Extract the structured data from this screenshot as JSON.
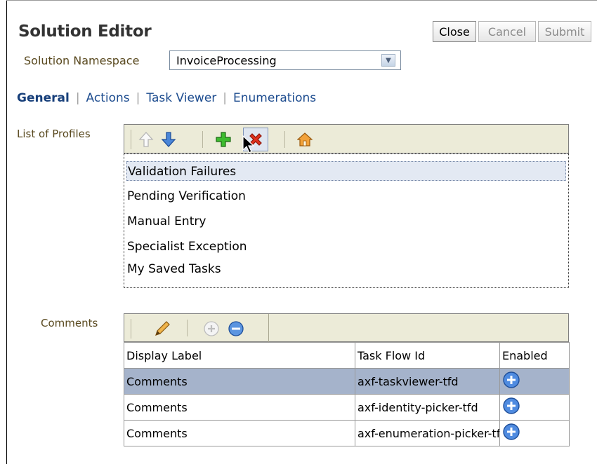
{
  "header": {
    "title": "Solution Editor",
    "buttons": {
      "close": "Close",
      "cancel": "Cancel",
      "submit": "Submit"
    }
  },
  "namespace": {
    "label": "Solution Namespace",
    "value": "InvoiceProcessing"
  },
  "tabs": [
    {
      "label": "General",
      "active": true
    },
    {
      "label": "Actions"
    },
    {
      "label": "Task Viewer"
    },
    {
      "label": "Enumerations"
    }
  ],
  "profiles": {
    "label": "List of Profiles",
    "toolbar_icons": [
      "move-up-icon",
      "move-down-icon",
      "add-icon",
      "delete-icon",
      "home-icon"
    ],
    "items": [
      "Validation Failures",
      "Pending Verification",
      "Manual Entry",
      "Specialist Exception",
      "My Saved Tasks"
    ]
  },
  "comments": {
    "label": "Comments",
    "toolbar_icons": [
      "edit-pencil-icon",
      "add-icon",
      "remove-icon"
    ],
    "columns": [
      "Display Label",
      "Task Flow Id",
      "Enabled"
    ],
    "rows": [
      {
        "label": "Comments",
        "task_flow_id": "axf-taskviewer-tfd"
      },
      {
        "label": "Comments",
        "task_flow_id": "axf-identity-picker-tfd"
      },
      {
        "label": "Comments",
        "task_flow_id": "axf-enumeration-picker-tfd"
      }
    ]
  },
  "colors": {
    "accent_link": "#1d4c8f",
    "toolbar_bg": "#ecebd8",
    "row_selected": "#a5b3cb",
    "list_selected": "#e3e9f3"
  }
}
